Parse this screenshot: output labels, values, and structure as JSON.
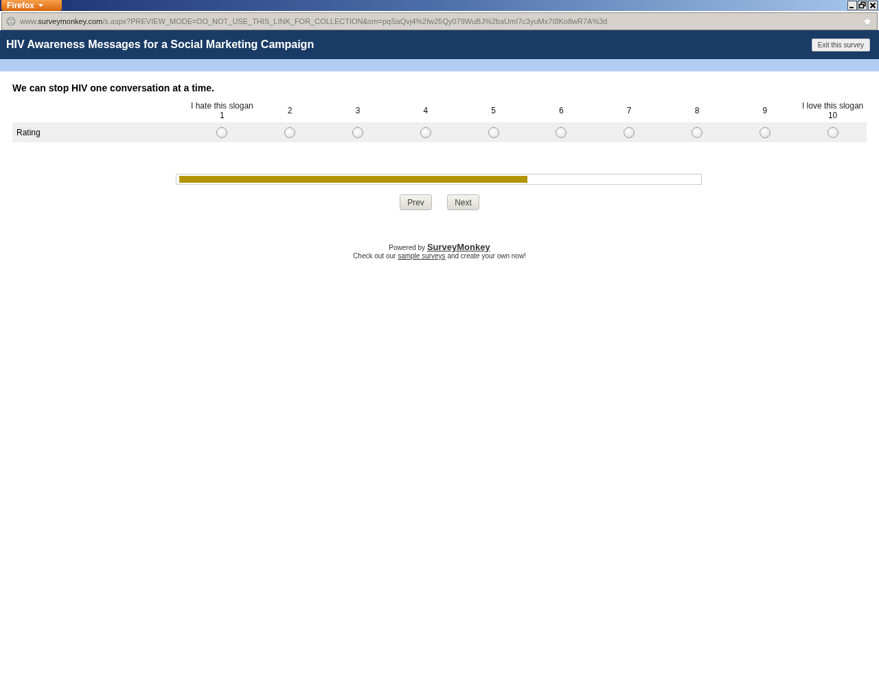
{
  "browser": {
    "menu_button": "Firefox",
    "url": {
      "prefix": "www.",
      "domain": "surveymonkey.com",
      "path": "/s.aspx?PREVIEW_MODE=DO_NOT_USE_THIS_LINK_FOR_COLLECTION&sm=pqSaQvj4%2fw25Qy079WuBJ%2baUmI7c3yuMx7I8Ko8wR7A%3d"
    }
  },
  "header": {
    "title": "HIV Awareness Messages for a Social Marketing Campaign",
    "exit_button": "Exit this survey"
  },
  "question": {
    "text": "We can stop HIV one conversation at a time.",
    "row_label": "Rating",
    "columns": [
      {
        "caption": "I hate this slogan",
        "number": "1",
        "selected": false
      },
      {
        "number": "2",
        "selected": false
      },
      {
        "number": "3",
        "selected": false
      },
      {
        "number": "4",
        "selected": false
      },
      {
        "number": "5",
        "selected": false
      },
      {
        "number": "6",
        "selected": false
      },
      {
        "number": "7",
        "selected": false
      },
      {
        "number": "8",
        "selected": false
      },
      {
        "number": "9",
        "selected": false
      },
      {
        "caption": "I love this slogan",
        "number": "10",
        "selected": false
      }
    ]
  },
  "progress": {
    "level": 0.67
  },
  "buttons": [
    "Prev",
    "Next"
  ],
  "footer": {
    "powered_by": "Powered by",
    "brand": "SurveyMonkey",
    "line_before": "Check out our ",
    "link": "sample surveys",
    "line_after": " and create your own now!"
  }
}
